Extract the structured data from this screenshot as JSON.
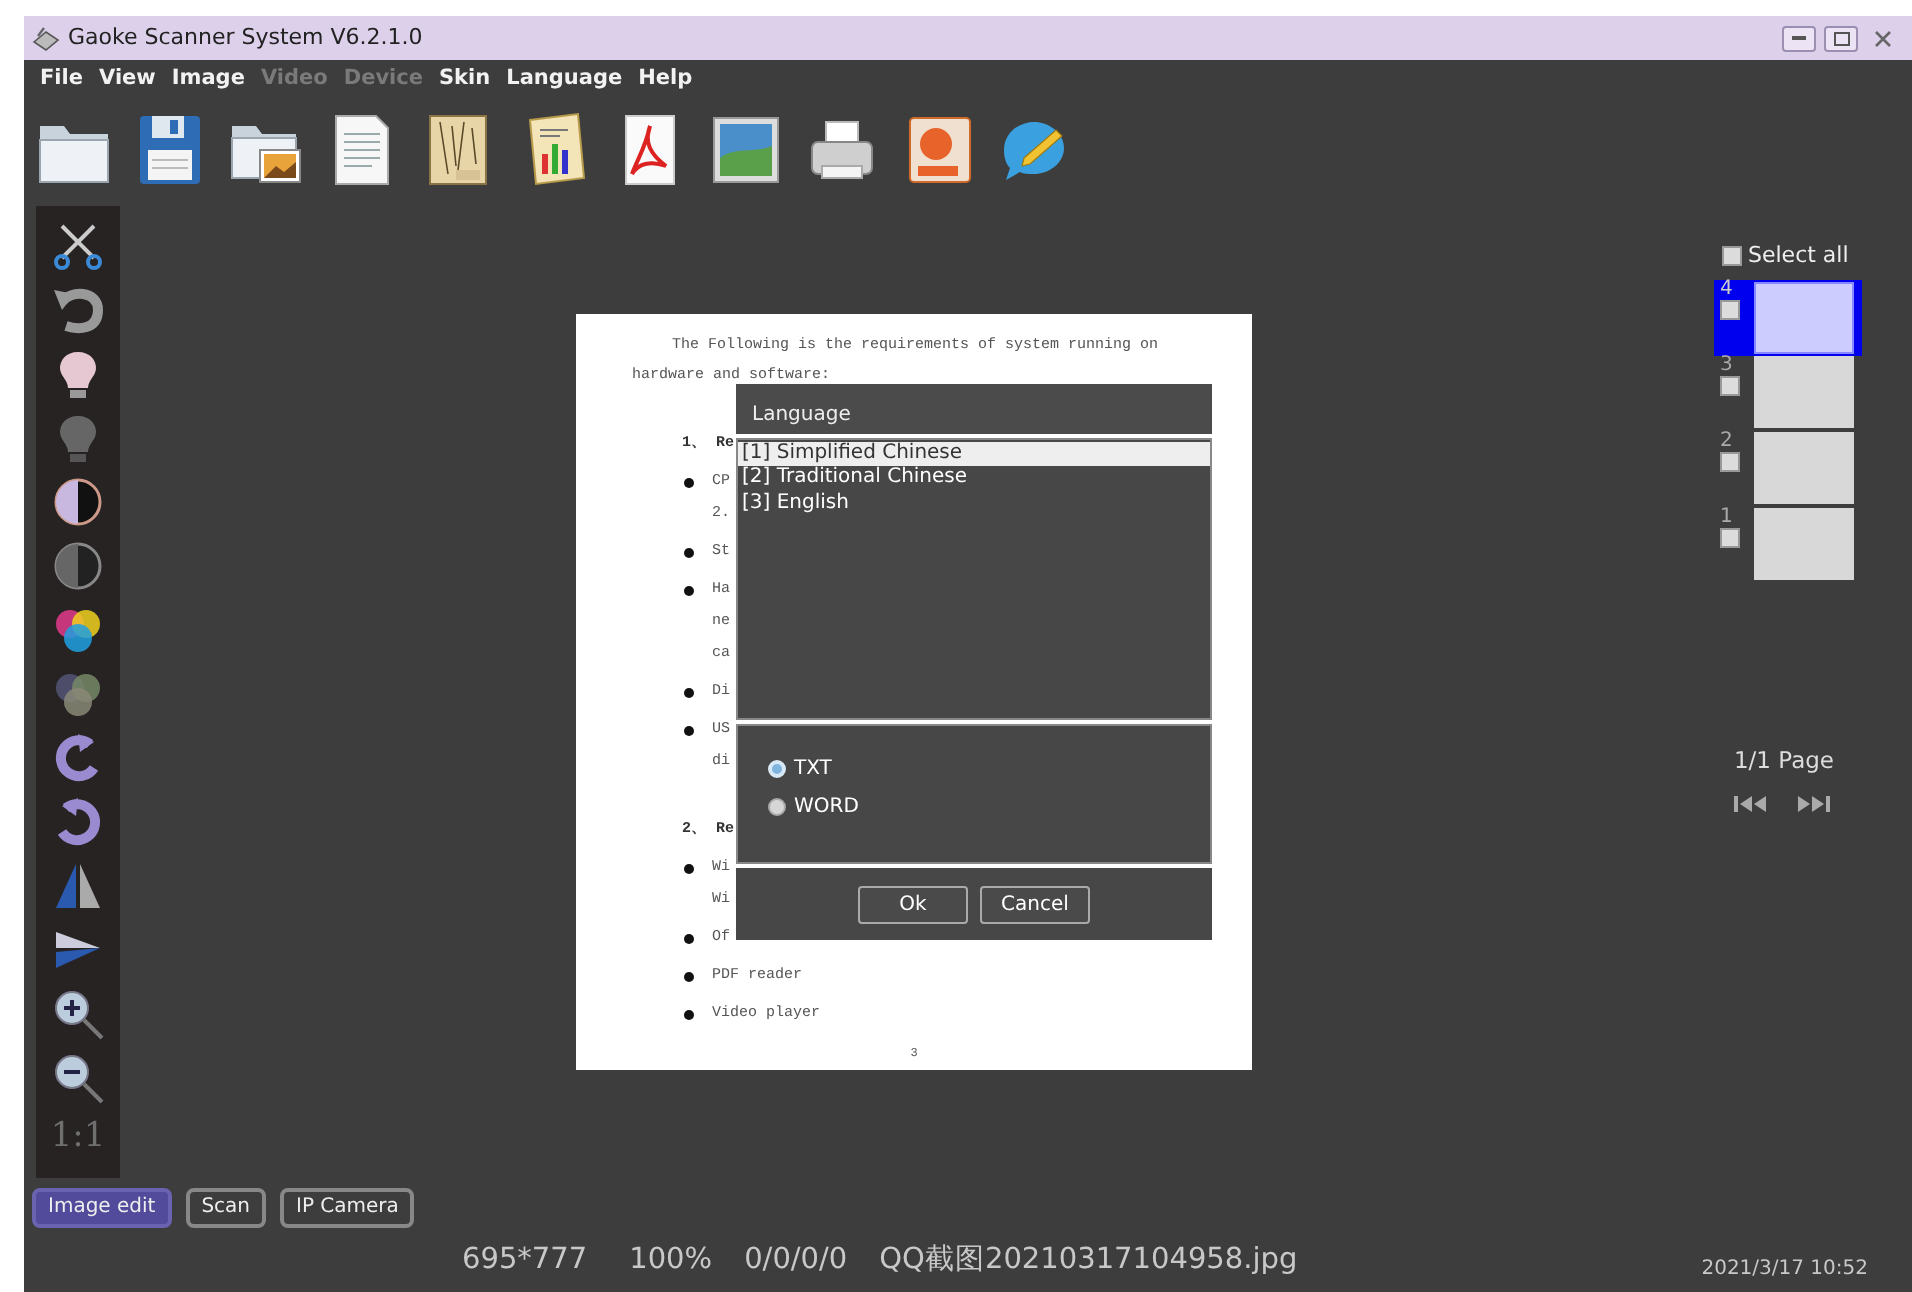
{
  "window": {
    "title": "Gaoke Scanner System V6.2.1.0"
  },
  "menu": [
    {
      "label": "File",
      "disabled": false
    },
    {
      "label": "View",
      "disabled": false
    },
    {
      "label": "Image",
      "disabled": false
    },
    {
      "label": "Video",
      "disabled": true
    },
    {
      "label": "Device",
      "disabled": true
    },
    {
      "label": "Skin",
      "disabled": false
    },
    {
      "label": "Language",
      "disabled": false
    },
    {
      "label": "Help",
      "disabled": false
    }
  ],
  "document": {
    "lines": [
      {
        "kind": "para",
        "text": "The Following is the requirements of system running on"
      },
      {
        "kind": "plain",
        "text": "hardware and software:"
      },
      {
        "kind": "heading",
        "text": "1、 Re"
      },
      {
        "kind": "bullet",
        "text": "CP"
      },
      {
        "kind": "cont",
        "text": "2."
      },
      {
        "kind": "bullet",
        "text": "St"
      },
      {
        "kind": "bullet",
        "text": "Ha"
      },
      {
        "kind": "cont",
        "text": "ne"
      },
      {
        "kind": "cont",
        "text": "ca"
      },
      {
        "kind": "bullet",
        "text": "Di"
      },
      {
        "kind": "bullet",
        "text": "US"
      },
      {
        "kind": "cont",
        "text": "di"
      },
      {
        "kind": "heading",
        "text": "2、 Re"
      },
      {
        "kind": "bullet",
        "text": "Wi"
      },
      {
        "kind": "cont",
        "text": "Wi"
      },
      {
        "kind": "bullet",
        "text": "Of"
      },
      {
        "kind": "bullet",
        "text": "PDF reader"
      },
      {
        "kind": "bullet",
        "text": "Video player"
      }
    ],
    "page_number": "3"
  },
  "dialog": {
    "title": "Language",
    "options": [
      {
        "label": "[1]  Simplified Chinese",
        "selected": true
      },
      {
        "label": "[2]  Traditional Chinese",
        "selected": false
      },
      {
        "label": "[3]  English",
        "selected": false
      }
    ],
    "formats": [
      {
        "label": "TXT",
        "selected": true
      },
      {
        "label": "WORD",
        "selected": false
      }
    ],
    "buttons": [
      "Ok",
      "Cancel"
    ]
  },
  "pages_panel": {
    "select_all": {
      "label": "Select all",
      "checked": false
    },
    "thumbnails": [
      {
        "number": "4",
        "checked": false,
        "selected": true
      },
      {
        "number": "3",
        "checked": false,
        "selected": false
      },
      {
        "number": "2",
        "checked": false,
        "selected": false
      },
      {
        "number": "1",
        "checked": false,
        "selected": false
      }
    ],
    "page_indicator": "1/1 Page"
  },
  "left_toolbar": {
    "zoom_label": "1:1"
  },
  "mode_tabs": [
    {
      "label": "Image edit",
      "selected": true
    },
    {
      "label": "Scan",
      "selected": false
    },
    {
      "label": "IP Camera",
      "selected": false
    }
  ],
  "status_bar": {
    "dimensions": "695*777",
    "zoom": "100%",
    "values": "0/0/0/0",
    "file_name": "QQ截图20210317104958.jpg",
    "datetime": "2021/3/17 10:52"
  }
}
